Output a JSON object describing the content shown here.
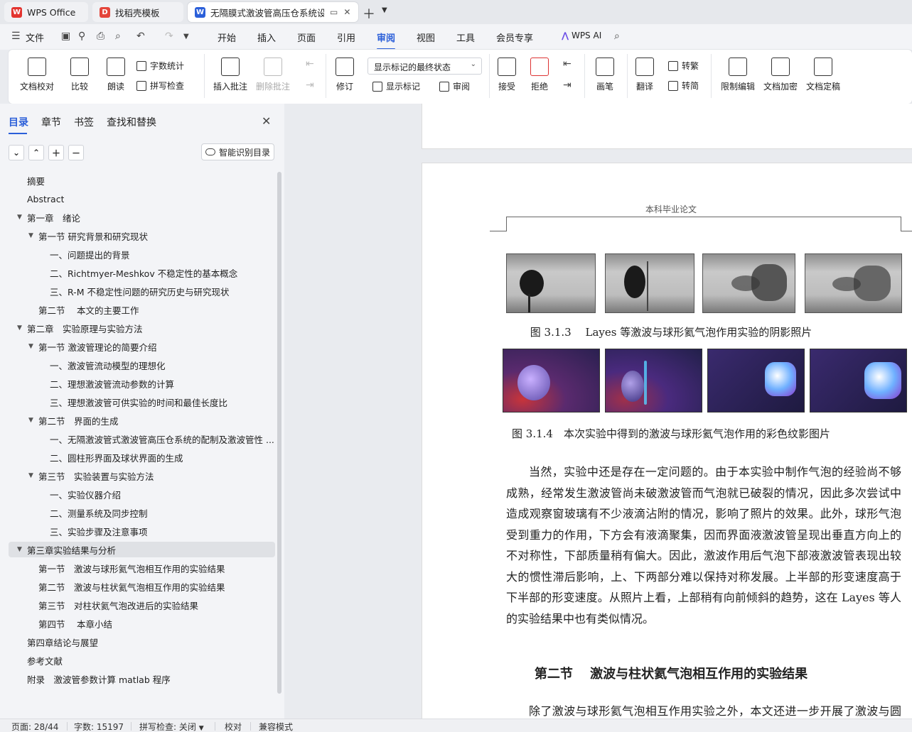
{
  "tabs": [
    {
      "label": "WPS Office",
      "icon": "wps-logo-icon"
    },
    {
      "label": "找稻壳模板",
      "icon": "docer-icon"
    },
    {
      "label": "无隔膜式激波管高压仓系统设计",
      "icon": "word-doc-icon"
    }
  ],
  "menu": {
    "file": "文件",
    "items": [
      "开始",
      "插入",
      "页面",
      "引用",
      "审阅",
      "视图",
      "工具",
      "会员专享"
    ],
    "active": "审阅",
    "ai": "WPS AI"
  },
  "ribbon": {
    "doc_check": "文档校对",
    "compare": "比较",
    "read_aloud": "朗读",
    "word_count": "字数统计",
    "spell_check": "拼写检查",
    "insert_comment": "插入批注",
    "delete_comment": "删除批注",
    "revise": "修订",
    "display_mode": "显示标记的最终状态",
    "show_markup": "显示标记",
    "review": "审阅",
    "accept": "接受",
    "reject": "拒绝",
    "pen": "画笔",
    "translate": "翻译",
    "to_traditional": "转繁",
    "to_simplified": "转简",
    "restrict_edit": "限制编辑",
    "encrypt": "文档加密",
    "finalize": "文档定稿"
  },
  "nav": {
    "tabs": [
      "目录",
      "章节",
      "书签",
      "查找和替换"
    ],
    "active_tab": "目录",
    "smart_button": "智能识别目录",
    "toc": [
      {
        "label": "摘要",
        "level": 1,
        "arrow": false
      },
      {
        "label": "Abstract",
        "level": 1,
        "arrow": false
      },
      {
        "label": "第一章　绪论",
        "level": 1,
        "arrow": true
      },
      {
        "label": "第一节  研究背景和研究现状",
        "level": 2,
        "arrow": true
      },
      {
        "label": "一、问题提出的背景",
        "level": 3,
        "arrow": false
      },
      {
        "label": "二、Richtmyer-Meshkov 不稳定性的基本概念",
        "level": 3,
        "arrow": false
      },
      {
        "label": "三、R-M 不稳定性问题的研究历史与研究现状",
        "level": 3,
        "arrow": false
      },
      {
        "label": "第二节　 本文的主要工作",
        "level": 2,
        "arrow": false
      },
      {
        "label": "第二章　实验原理与实验方法",
        "level": 1,
        "arrow": true
      },
      {
        "label": "第一节  激波管理论的简要介绍",
        "level": 2,
        "arrow": true
      },
      {
        "label": "一、激波管流动模型的理想化",
        "level": 3,
        "arrow": false
      },
      {
        "label": "二、理想激波管流动参数的计算",
        "level": 3,
        "arrow": false
      },
      {
        "label": "三、理想激波管可供实验的时间和最佳长度比",
        "level": 3,
        "arrow": false
      },
      {
        "label": "第二节　界面的生成",
        "level": 2,
        "arrow": true
      },
      {
        "label": "一、无隔激波管式激波管高压仓系统的配制及激波管性 ...",
        "level": 3,
        "arrow": false
      },
      {
        "label": "二、圆柱形界面及球状界面的生成",
        "level": 3,
        "arrow": false
      },
      {
        "label": "第三节　实验装置与实验方法",
        "level": 2,
        "arrow": true
      },
      {
        "label": "一、实验仪器介绍",
        "level": 3,
        "arrow": false
      },
      {
        "label": "二、测量系统及同步控制",
        "level": 3,
        "arrow": false
      },
      {
        "label": "三、实验步骤及注意事项",
        "level": 3,
        "arrow": false
      },
      {
        "label": "第三章实验结果与分析",
        "level": 1,
        "arrow": true,
        "selected": true
      },
      {
        "label": "第一节　激波与球形氦气泡相互作用的实验结果",
        "level": 2,
        "arrow": false
      },
      {
        "label": "第二节　激波与柱状氦气泡相互作用的实验结果",
        "level": 2,
        "arrow": false
      },
      {
        "label": "第三节　对柱状氦气泡改进后的实验结果",
        "level": 2,
        "arrow": false
      },
      {
        "label": "第四节　 本章小结",
        "level": 2,
        "arrow": false
      },
      {
        "label": "第四章结论与展望",
        "level": 1,
        "arrow": false
      },
      {
        "label": "参考文献",
        "level": 1,
        "arrow": false
      },
      {
        "label": "附录　激波管参数计算 matlab 程序",
        "level": 1,
        "arrow": false
      }
    ]
  },
  "document": {
    "header": "本科毕业论文",
    "caption1": "图 3.1.3　 Layes 等激波与球形氦气泡作用实验的阴影照片",
    "caption2": "图 3.1.4　本次实验中得到的激波与球形氦气泡作用的彩色纹影图片",
    "paragraph1": "当然，实验中还是存在一定问题的。由于本实验中制作气泡的经验尚不够成熟，经常发生激波管尚未破激波管而气泡就已破裂的情况，因此多次尝试中造成观察窗玻璃有不少液滴沾附的情况，影响了照片的效果。此外，球形气泡受到重力的作用，下方会有液滴聚集，因而界面液激波管呈现出垂直方向上的不对称性，下部质量稍有偏大。因此，激波作用后气泡下部液激波管表现出较大的惯性滞后影响，上、下两部分难以保持对称发展。上半部的形变速度高于下半部的形变速度。从照片上看，上部稍有向前倾斜的趋势，这在 Layes 等人的实验结果中也有类似情况。",
    "section_heading": "第二节　 激波与柱状氦气泡相互作用的实验结果",
    "paragraph2": "除了激波与球形氦气泡相互作用实验之外，本文还进一步开展了激波与圆柱"
  },
  "status": {
    "page": "页面: 28/44",
    "words": "字数: 15197",
    "spell": "拼写检查: 关闭",
    "proof": "校对",
    "compat": "兼容模式"
  },
  "colors": {
    "accent": "#2b5fd9",
    "wps_red": "#e3342f",
    "docer_red": "#e4453a",
    "word_blue": "#2b5fd9"
  }
}
